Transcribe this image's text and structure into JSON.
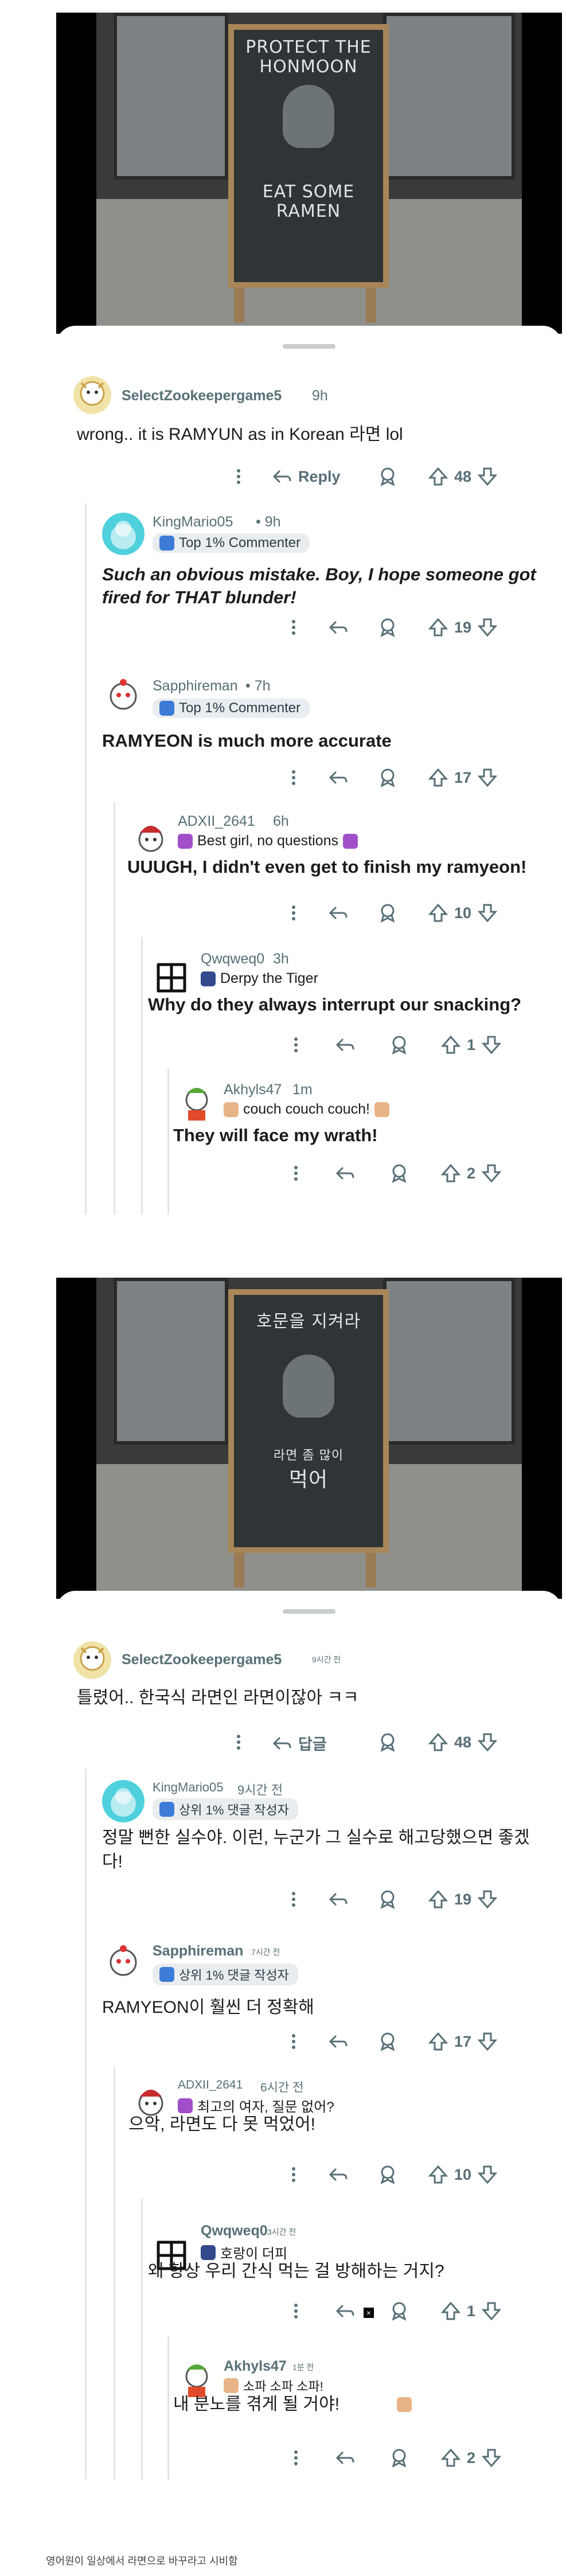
{
  "post_en": {
    "image_text": [
      "PROTECT THE",
      "HONMOON",
      "EAT SOME",
      "RAMEN"
    ],
    "comments": [
      {
        "user": "SelectZookeepergame5",
        "meta": "9h",
        "flair": "",
        "body": "wrong.. it is RAMYUN as in Korean 라면 lol",
        "reply": "Reply",
        "votes": "48"
      },
      {
        "user": "KingMario05",
        "meta": "• 9h",
        "flair": "Top 1% Commenter",
        "body": "Such an obvious mistake. Boy, I hope someone got fired for THAT blunder!",
        "votes": "19"
      },
      {
        "user": "Sapphireman",
        "meta": "• 7h",
        "flair": "Top 1% Commenter",
        "body": "RAMYEON is much more accurate",
        "votes": "17"
      },
      {
        "user": "ADXII_2641",
        "meta": "6h",
        "flair": "Best girl, no questions",
        "body": "UUUGH, I didn't even get to finish my ramyeon!",
        "votes": "10"
      },
      {
        "user": "Qwqweq0",
        "meta": "3h",
        "flair": "Derpy the Tiger",
        "body": "Why do they always interrupt our snacking?",
        "votes": "1"
      },
      {
        "user": "Akhyls47",
        "meta": "1m",
        "flair": "couch couch couch!",
        "body": "They will face my wrath!",
        "votes": "2"
      }
    ]
  },
  "post_ko": {
    "image_text": [
      "호문을 지켜라",
      "라면 좀 많이",
      "먹어"
    ],
    "comments": [
      {
        "user": "SelectZookeepergame5",
        "meta": "9시간 전",
        "flair": "",
        "body": "틀렸어.. 한국식 라면인 라면이잖아 ㅋㅋ",
        "reply": "답글",
        "votes": "48"
      },
      {
        "user": "KingMario05",
        "meta": "9시간 전",
        "flair": "상위 1% 댓글 작성자",
        "body": "정말 뻔한 실수야. 이런, 누군가 그 실수로 해고당했으면 좋겠다!",
        "votes": "19"
      },
      {
        "user": "Sapphireman",
        "meta": "7시간 전",
        "flair": "상위 1% 댓글 작성자",
        "body": "RAMYEON이 훨씬 더 정확해",
        "votes": "17"
      },
      {
        "user": "ADXII_2641",
        "meta": "6시간 전",
        "flair": "최고의 여자, 질문 없어?",
        "body": "으악, 라면도 다 못 먹었어!",
        "votes": "10"
      },
      {
        "user": "Qwqweq0",
        "meta": "3시간 전",
        "flair": "호랑이 더피",
        "body": "왜 항상 우리 간식 먹는 걸 방해하는 거지?",
        "votes": "1"
      },
      {
        "user": "Akhyls47",
        "meta": "1분 전",
        "flair": "소파 소파 소파!",
        "body": "내 분노를 겪게 될 거야!",
        "votes": "2"
      }
    ]
  },
  "caption": "영어원이 일상에서 라면으로 바꾸라고 시비함",
  "colors": {
    "meta": "#576f76",
    "flair_bg": "#eaedef",
    "thread": "#e2e5e7"
  }
}
